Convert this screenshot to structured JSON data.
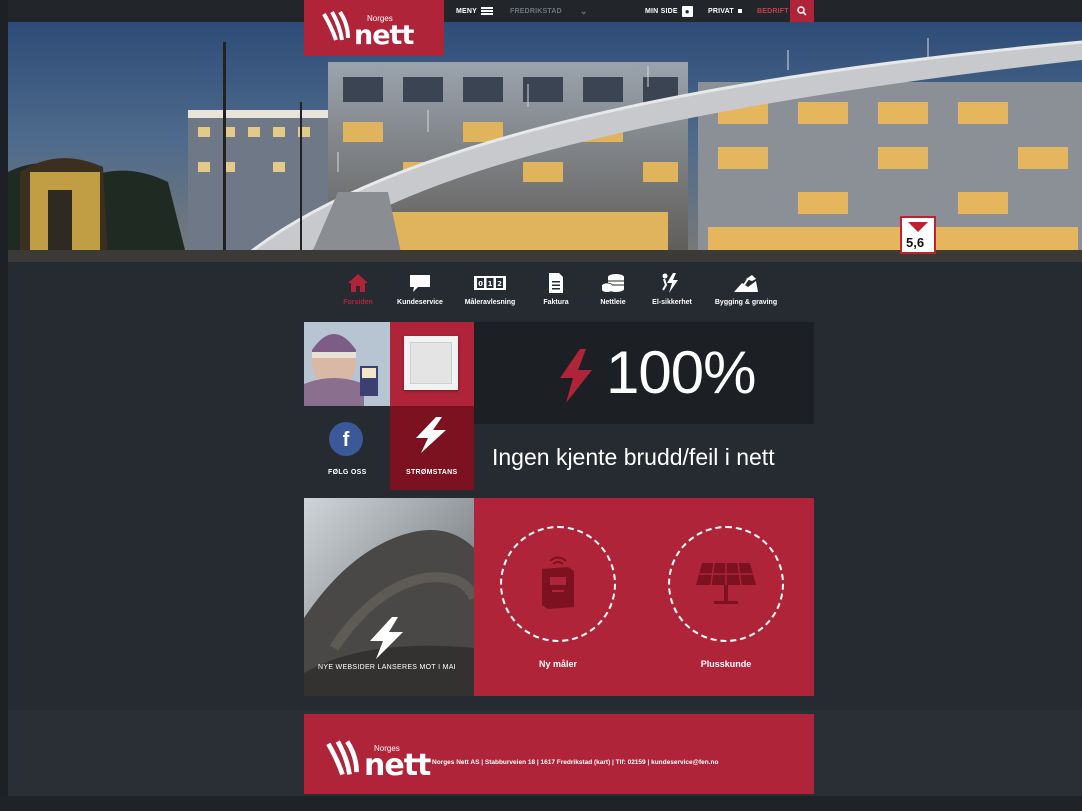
{
  "header": {
    "logo_small": "Norges",
    "logo_big": "nett",
    "menu_label": "MENY",
    "region_label": "FREDRIKSTAD",
    "minside_label": "MIN SIDE",
    "privat_label": "PRIVAT",
    "bedrift_label": "BEDRIFT"
  },
  "hero": {
    "sign_value": "5,6"
  },
  "nav": {
    "items": [
      {
        "label": "Forsiden",
        "icon": "home-icon",
        "active": true
      },
      {
        "label": "Kundeservice",
        "icon": "chat-icon",
        "active": false
      },
      {
        "label": "Måleravlesning",
        "icon": "meter-counter-icon",
        "active": false
      },
      {
        "label": "Faktura",
        "icon": "invoice-icon",
        "active": false
      },
      {
        "label": "Nettleie",
        "icon": "coins-icon",
        "active": false
      },
      {
        "label": "El-sikkerhet",
        "icon": "electric-hazard-icon",
        "active": false
      },
      {
        "label": "Bygging & graving",
        "icon": "excavator-icon",
        "active": false
      }
    ]
  },
  "tiles": {
    "follow_label": "FØLG OSS",
    "outage_label": "STRØMSTANS",
    "status_percent": "100%",
    "status_text": "Ingen kjente brudd/feil i nett",
    "news_label": "NYE WEBSIDER LANSERES MOT I MAI",
    "meter_label": "Ny måler",
    "plus_label": "Plusskunde"
  },
  "footer": {
    "logo_small": "Norges",
    "logo_big": "nett",
    "text": "Norges Nett AS | Stabburveien 18 | 1617 Fredrikstad (kart) | Tlf: 02159 | kundeservice@fen.no"
  },
  "colors": {
    "brand_red": "#b0243a",
    "dark_bg": "#262b31",
    "panel_dark": "#1c2024"
  }
}
